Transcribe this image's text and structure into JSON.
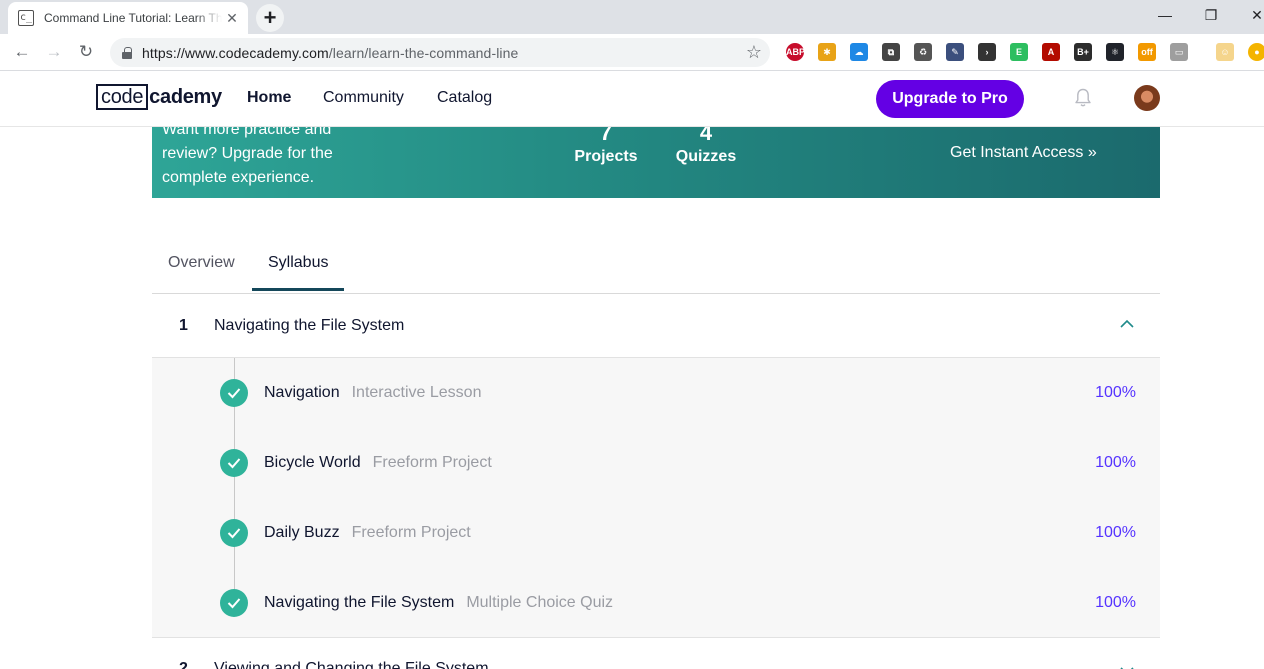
{
  "browser": {
    "tab_title": "Command Line Tutorial: Learn Th",
    "tab_favicon": "c_",
    "url_host": "https://www.codecademy.com",
    "url_path": "/learn/learn-the-command-line",
    "extensions": [
      {
        "name": "adblock-plus-icon",
        "label": "ABP",
        "color": "#c70d2c"
      },
      {
        "name": "extension-tool-icon",
        "label": "✱",
        "color": "#e8a317"
      },
      {
        "name": "cloud-icon",
        "label": "☁",
        "color": "#1e88e5"
      },
      {
        "name": "code-icon",
        "label": "⧉",
        "color": "#444444"
      },
      {
        "name": "recycle-icon",
        "label": "♻",
        "color": "#555555"
      },
      {
        "name": "eyedropper-icon",
        "label": "✎",
        "color": "#3b4f7d"
      },
      {
        "name": "terminal-icon",
        "label": "›",
        "color": "#333333"
      },
      {
        "name": "evernote-icon",
        "label": "E",
        "color": "#2dbe60"
      },
      {
        "name": "pdf-icon",
        "label": "A",
        "color": "#b30b00"
      },
      {
        "name": "bplus-icon",
        "label": "B+",
        "color": "#2c2c2c"
      },
      {
        "name": "react-devtools-icon",
        "label": "⚛",
        "color": "#20232a"
      },
      {
        "name": "off-badge-icon",
        "label": "off",
        "color": "#f29900"
      },
      {
        "name": "cast-icon",
        "label": "▭",
        "color": "#9e9e9e"
      },
      {
        "name": "profile-icon",
        "label": "☺",
        "color": "#f5d58c"
      },
      {
        "name": "notification-ext-icon",
        "label": "●",
        "color": "#f4b400"
      }
    ]
  },
  "header": {
    "logo_boxed": "code",
    "logo_rest": "cademy",
    "nav": [
      "Home",
      "Community",
      "Catalog"
    ],
    "upgrade_label": "Upgrade to Pro"
  },
  "banner": {
    "text": "Want more practice and review? Upgrade for the complete experience.",
    "projects_count": "7",
    "projects_label": "Projects",
    "quizzes_count": "4",
    "quizzes_label": "Quizzes",
    "cta": "Get Instant Access »"
  },
  "tabs": {
    "overview": "Overview",
    "syllabus": "Syllabus"
  },
  "syllabus": {
    "module1": {
      "num": "1",
      "title": "Navigating the File System",
      "lessons": [
        {
          "title": "Navigation",
          "type": "Interactive Lesson",
          "progress": "100%"
        },
        {
          "title": "Bicycle World",
          "type": "Freeform Project",
          "progress": "100%"
        },
        {
          "title": "Daily Buzz",
          "type": "Freeform Project",
          "progress": "100%"
        },
        {
          "title": "Navigating the File System",
          "type": "Multiple Choice Quiz",
          "progress": "100%"
        }
      ]
    },
    "module2": {
      "num": "2",
      "title": "Viewing and Changing the File System"
    }
  },
  "colors": {
    "brand_purple": "#6400e4",
    "check_green": "#2fb39a",
    "progress_blue": "#5533ff",
    "banner_teal": "#238982"
  }
}
